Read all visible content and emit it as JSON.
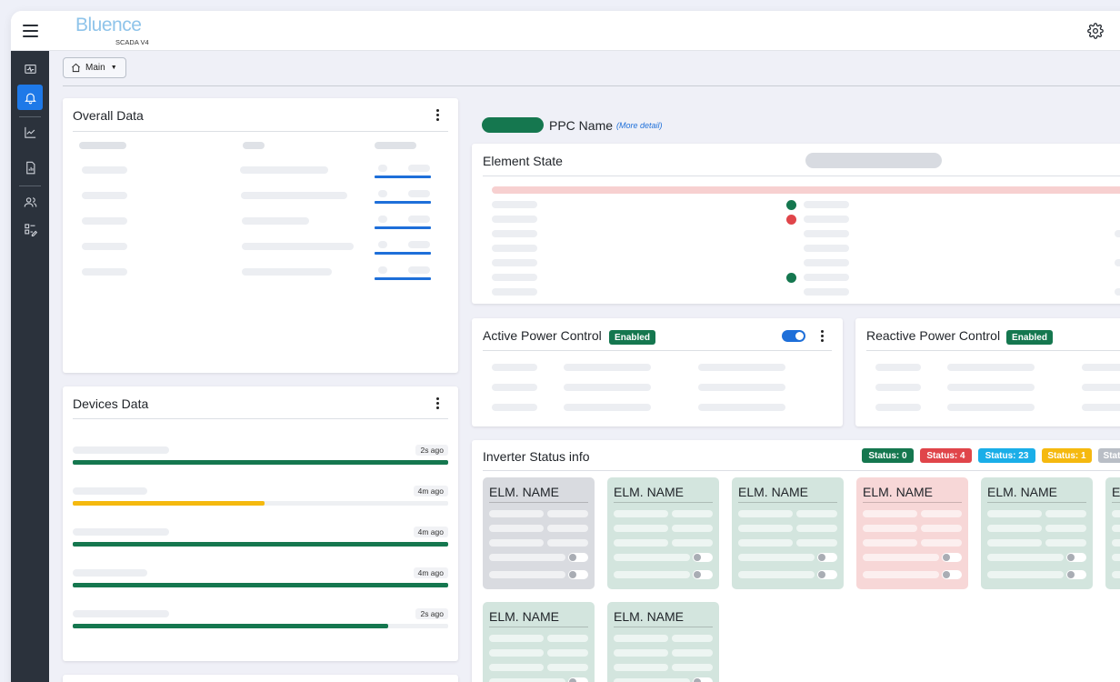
{
  "app": {
    "name": "Bluence",
    "subtitle": "SCADA V4"
  },
  "nav": {
    "main_label": "Main"
  },
  "overall_data": {
    "title": "Overall Data"
  },
  "devices_data": {
    "title": "Devices Data",
    "rows": [
      {
        "time": "2s ago",
        "progress": 1.0,
        "color": "#15774f"
      },
      {
        "time": "4m ago",
        "progress": 0.51,
        "color": "#f5b90f"
      },
      {
        "time": "4m ago",
        "progress": 1.0,
        "color": "#15774f"
      },
      {
        "time": "4m ago",
        "progress": 1.0,
        "color": "#15774f"
      },
      {
        "time": "2s ago",
        "progress": 0.84,
        "color": "#15774f"
      }
    ]
  },
  "ppc": {
    "name": "PPC Name",
    "more_detail": "(More detail)"
  },
  "element_state": {
    "title": "Element State"
  },
  "active_power": {
    "title": "Active Power Control",
    "status": "Enabled",
    "toggle_on": true
  },
  "reactive_power": {
    "title": "Reactive Power Control",
    "status": "Enabled"
  },
  "inverter": {
    "title": "Inverter Status info",
    "badges": [
      {
        "label": "Status: 0",
        "color": "#15774f"
      },
      {
        "label": "Status: 4",
        "color": "#e0454a"
      },
      {
        "label": "Status: 23",
        "color": "#1aaee8"
      },
      {
        "label": "Status: 1",
        "color": "#f5b90f"
      },
      {
        "label": "Stat",
        "color": "#b9bec6"
      }
    ],
    "elements": [
      {
        "name": "ELM. NAME",
        "color": "#d9dbe0"
      },
      {
        "name": "ELM. NAME",
        "color": "#d3e5de"
      },
      {
        "name": "ELM. NAME",
        "color": "#d3e5de"
      },
      {
        "name": "ELM. NAME",
        "color": "#f7d7d7"
      },
      {
        "name": "ELM. NAME",
        "color": "#d3e5de"
      },
      {
        "name": "ELM. NAME",
        "color": "#d3e5de"
      },
      {
        "name": "ELM. NAME",
        "color": "#d3e5de"
      },
      {
        "name": "ELM. NAME",
        "color": "#d3e5de"
      }
    ]
  },
  "colors": {
    "accent": "#1e79e8",
    "ok": "#15774f",
    "error": "#e0454a",
    "sidebar": "#2b323c"
  }
}
